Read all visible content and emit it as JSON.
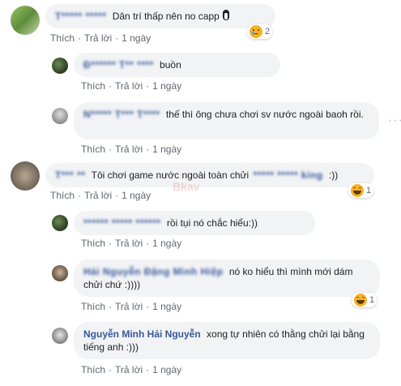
{
  "actions": {
    "like": "Thích",
    "reply": "Trả lời",
    "dot": "·"
  },
  "watermark": "Bkav",
  "comments": [
    {
      "name": "T***** *****",
      "text": "Dân trí thấp nên no capp",
      "time": "1 ngày",
      "reaction_count": "2",
      "reaction": "sad"
    },
    {
      "name": "Đ****** T** ****",
      "text": "buồn",
      "time": "1 ngày"
    },
    {
      "name": "N***** T*** T****",
      "text": "thế thì ông chưa chơi sv nước ngoài baoh rồi.",
      "time": "1 ngày"
    },
    {
      "name": "T*** **",
      "text": "Tôi chơi game nước ngoài toàn chửi",
      "mention": "***** ***** king",
      "text_end": ":))",
      "time": "1 ngày",
      "reaction_count": "1",
      "reaction": "haha"
    },
    {
      "name": "****** ***** ******",
      "text": "rồi tụi nó chắc hiểu:))",
      "time": "1 ngày"
    },
    {
      "name": "Hải Nguyễn Đặng Minh Hiệp",
      "text": "nó ko hiểu thì mình mới dám chửi chứ :))))",
      "time": "1 ngày",
      "reaction_count": "1",
      "reaction": "haha"
    },
    {
      "name": "Nguyễn Minh Hải Nguyễn",
      "text": "xong tự nhiên có thằng chửi lại bằng tiếng anh :)))",
      "time": "1 ngày"
    }
  ]
}
